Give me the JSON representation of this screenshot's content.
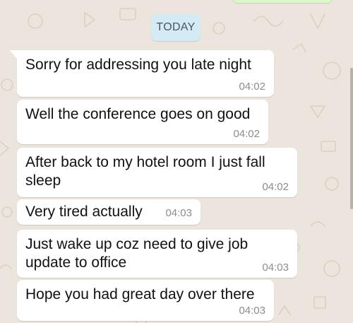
{
  "chat": {
    "date_divider": "TODAY",
    "messages": [
      {
        "text": "Sorry for addressing you late night",
        "time": "04:02"
      },
      {
        "text": "Well the conference goes on good",
        "time": "04:02"
      },
      {
        "text": "After back to my hotel room I just fall sleep",
        "time": "04:02"
      },
      {
        "text": "Very tired actually",
        "time": "04:03"
      },
      {
        "text": "Just wake up coz need to give job update to office",
        "time": "04:03"
      },
      {
        "text": "Hope you had great day over there",
        "time": "04:03"
      }
    ]
  },
  "colors": {
    "wallpaper": "#ece5dd",
    "incoming_bubble": "#ffffff",
    "outgoing_bubble": "#dcf8c6",
    "date_pill": "#d4eaf4",
    "timestamp": "#8c8c8c"
  }
}
